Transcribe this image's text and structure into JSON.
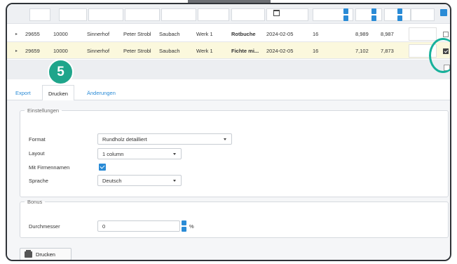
{
  "rows": [
    {
      "c1": "29655",
      "c2": "10000",
      "c3": "Sinnerhof",
      "c4": "Peter Strobl",
      "c5": "Saubach",
      "c6": "Werk 1",
      "c7": "Rotbuche",
      "c8": "2024-02-05",
      "c9": "16",
      "c10": "8,989",
      "c11": "8,987",
      "checked": false
    },
    {
      "c1": "29659",
      "c2": "10000",
      "c3": "Sinnerhof",
      "c4": "Peter Strobl",
      "c5": "Saubach",
      "c6": "Werk 1",
      "c7": "Fichte mi...",
      "c8": "2024-02-05",
      "c9": "16",
      "c10": "7,102",
      "c11": "7,873",
      "checked": true
    }
  ],
  "step_badge": "5",
  "tabs": [
    {
      "label": "Export",
      "active": false
    },
    {
      "label": "Drucken",
      "active": true
    },
    {
      "label": "Änderungen",
      "active": false
    }
  ],
  "settings": {
    "legend": "Einstellungen",
    "format_label": "Format",
    "format_value": "Rundholz detailliert",
    "layout_label": "Layout",
    "layout_value": "1 column",
    "company_label": "Mit Firmennamen",
    "company_checked": true,
    "language_label": "Sprache",
    "language_value": "Deutsch"
  },
  "bonus": {
    "legend": "Bonus",
    "diameter_label": "Durchmesser",
    "diameter_value": "0",
    "unit": "%"
  },
  "print_button": "Drucken",
  "colors": {
    "accent": "#2a8bd6",
    "badge": "#1fa58b",
    "highlight_row": "#fbf8dd"
  }
}
